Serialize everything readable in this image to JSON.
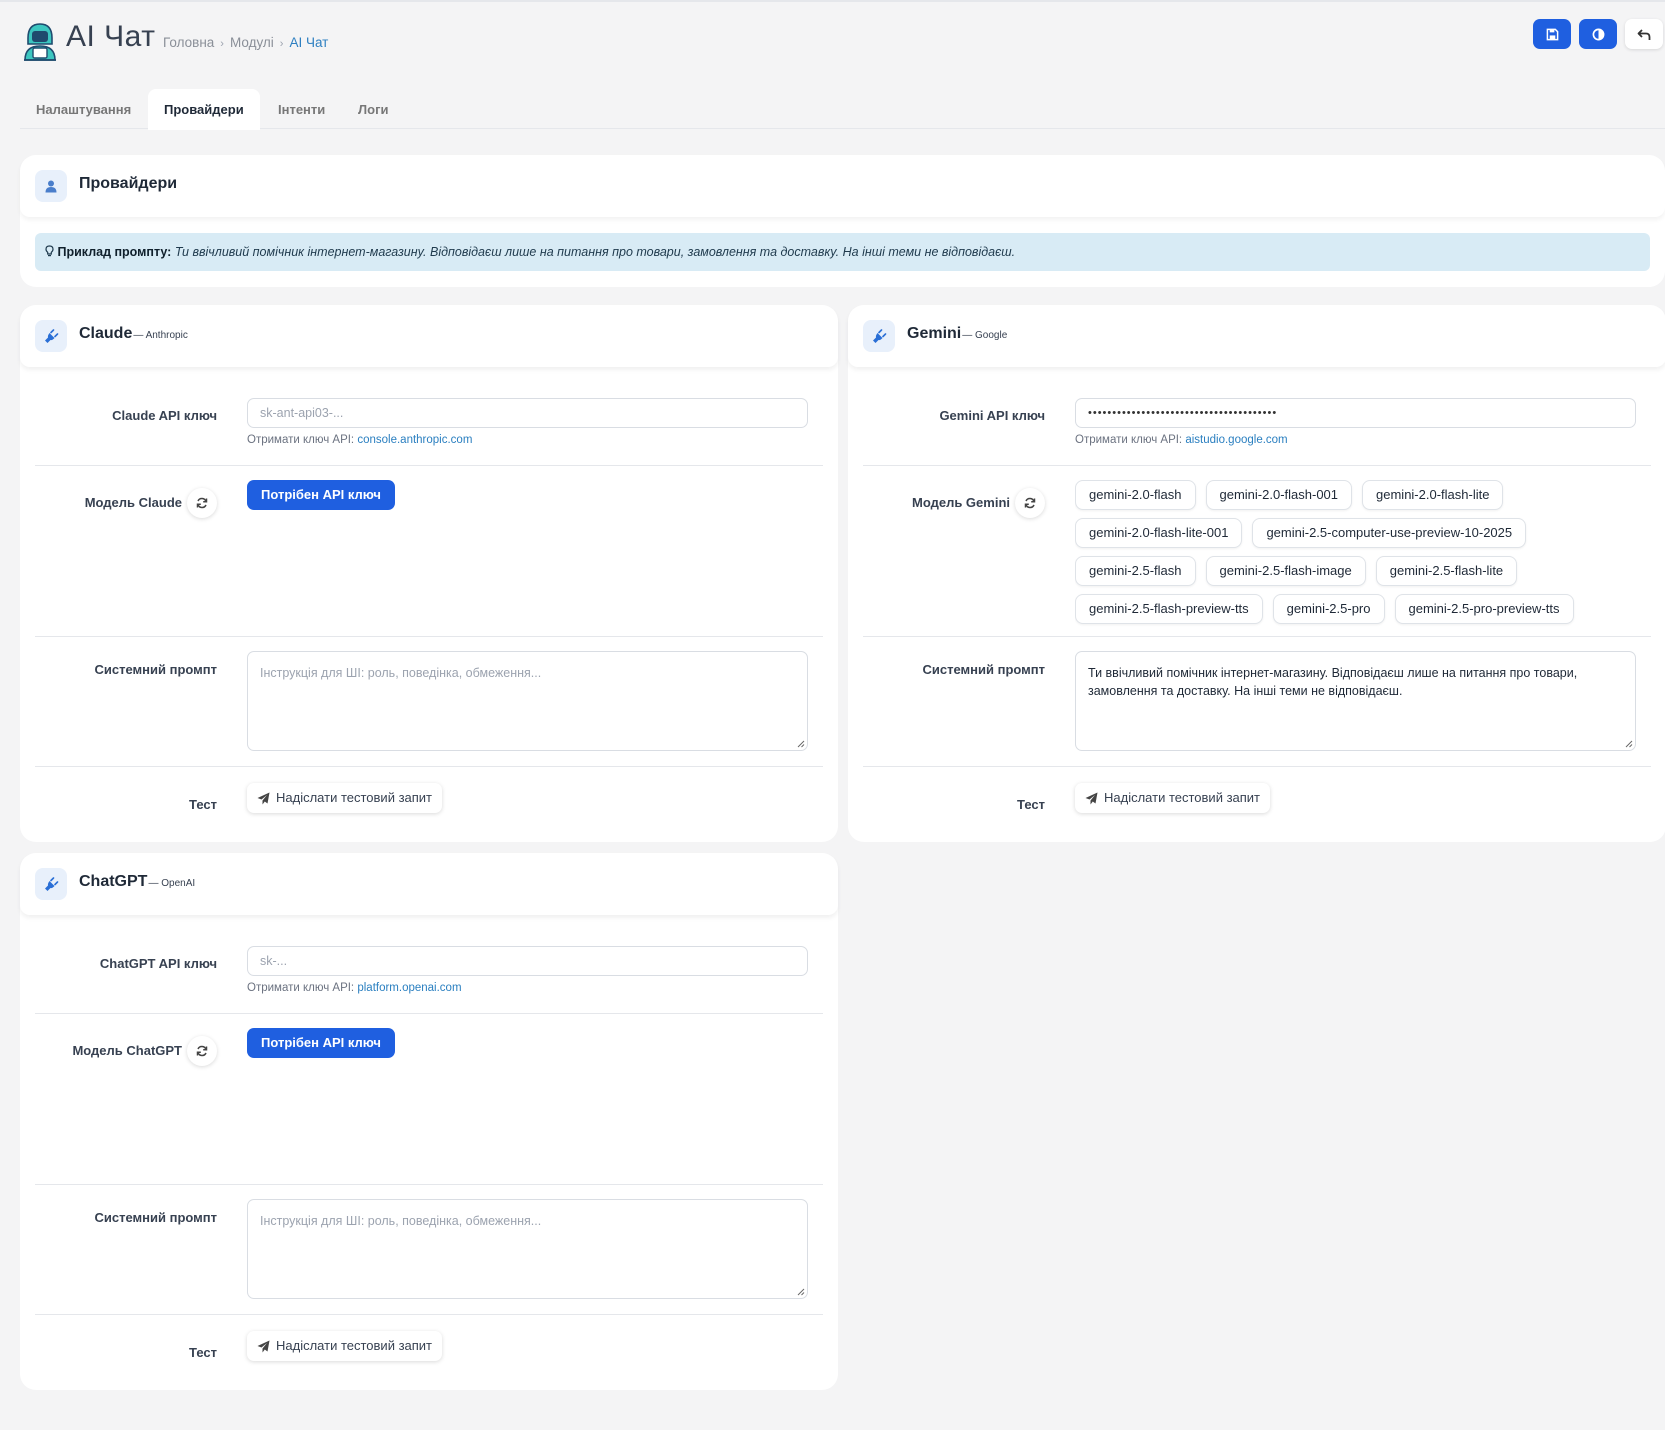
{
  "header": {
    "title": "AI Чат",
    "breadcrumb": [
      "Головна",
      "Модулі",
      "AI Чат"
    ]
  },
  "tabs": [
    "Налаштування",
    "Провайдери",
    "Інтенти",
    "Логи"
  ],
  "providers_section": {
    "title": "Провайдери",
    "example_label": "Приклад промпту:",
    "example_text": "Ти ввічливий помічник інтернет-магазину. Відповідаєш лише на питання про товари, замовлення та доставку. На інші теми не відповідаєш."
  },
  "claude": {
    "name": "Claude",
    "vendor": "— Anthropic",
    "api_label": "Claude API ключ",
    "api_placeholder": "sk-ant-api03-...",
    "helper_prefix": "Отримати ключ API:",
    "helper_link": "console.anthropic.com",
    "model_label": "Модель Claude",
    "need_key": "Потрібен API ключ",
    "prompt_label": "Системний промпт",
    "prompt_placeholder": "Інструкція для ШІ: роль, поведінка, обмеження...",
    "test_label": "Тест",
    "test_button": "Надіслати тестовий запит"
  },
  "gemini": {
    "name": "Gemini",
    "vendor": "— Google",
    "api_label": "Gemini API ключ",
    "api_value": "•••••••••••••••••••••••••••••••••••••••",
    "helper_prefix": "Отримати ключ API:",
    "helper_link": "aistudio.google.com",
    "model_label": "Модель Gemini",
    "models": [
      "gemini-2.0-flash",
      "gemini-2.0-flash-001",
      "gemini-2.0-flash-lite",
      "gemini-2.0-flash-lite-001",
      "gemini-2.5-computer-use-preview-10-2025",
      "gemini-2.5-flash",
      "gemini-2.5-flash-image",
      "gemini-2.5-flash-lite",
      "gemini-2.5-flash-preview-tts",
      "gemini-2.5-pro",
      "gemini-2.5-pro-preview-tts"
    ],
    "prompt_label": "Системний промпт",
    "prompt_value": "Ти ввічливий помічник інтернет-магазину. Відповідаєш лише на питання про товари, замовлення та доставку. На інші теми не відповідаєш.",
    "test_label": "Тест",
    "test_button": "Надіслати тестовий запит"
  },
  "chatgpt": {
    "name": "ChatGPT",
    "vendor": "— OpenAI",
    "api_label": "ChatGPT API ключ",
    "api_placeholder": "sk-...",
    "helper_prefix": "Отримати ключ API:",
    "helper_link": "platform.openai.com",
    "model_label": "Модель ChatGPT",
    "need_key": "Потрібен API ключ",
    "prompt_label": "Системний промпт",
    "prompt_placeholder": "Інструкція для ШІ: роль, поведінка, обмеження...",
    "test_label": "Тест",
    "test_button": "Надіслати тестовий запит"
  },
  "icons": {
    "save": "save-icon",
    "theme": "contrast-icon",
    "back": "undo-icon",
    "plug": "plug-icon",
    "user": "user-icon",
    "refresh": "refresh-icon",
    "send": "paper-plane-icon",
    "bulb": "lightbulb-icon"
  },
  "colors": {
    "primary": "#1f5fe0",
    "link": "#2a7fc0",
    "alert_bg": "#d8ebf5"
  }
}
